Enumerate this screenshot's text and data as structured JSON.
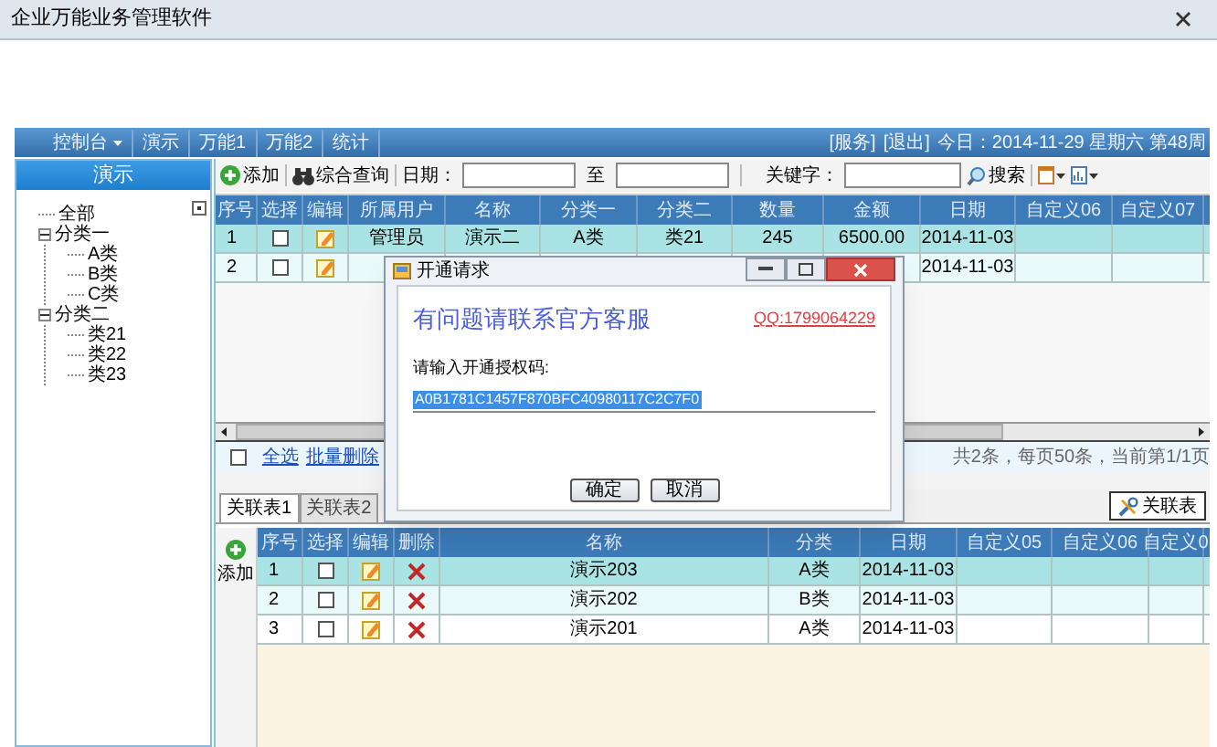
{
  "window": {
    "title": "企业万能业务管理软件"
  },
  "menu": {
    "items": [
      {
        "label": "控制台",
        "dropdown": true
      },
      {
        "label": "演示",
        "dropdown": false
      },
      {
        "label": "万能1",
        "dropdown": false
      },
      {
        "label": "万能2",
        "dropdown": false
      },
      {
        "label": "统计",
        "dropdown": false
      }
    ],
    "links": [
      "[服务]",
      "[退出]"
    ],
    "today": "今日：2014-11-29 星期六 第48周"
  },
  "sidebar": {
    "title": "演示",
    "tree": [
      {
        "label": "全部"
      },
      {
        "label": "分类一",
        "expanded": true,
        "children": [
          {
            "label": "A类"
          },
          {
            "label": "B类"
          },
          {
            "label": "C类"
          }
        ]
      },
      {
        "label": "分类二",
        "expanded": true,
        "children": [
          {
            "label": "类21"
          },
          {
            "label": "类22"
          },
          {
            "label": "类23"
          }
        ]
      }
    ]
  },
  "toolbar": {
    "add": "添加",
    "query": "综合查询",
    "date_label": "日期：",
    "to_label": "至",
    "keyword_label": "关键字：",
    "search": "搜索"
  },
  "grid": {
    "columns": [
      "序号",
      "选择",
      "编辑",
      "所属用户",
      "名称",
      "分类一",
      "分类二",
      "数量",
      "金额",
      "日期",
      "自定义06",
      "自定义07"
    ],
    "rows": [
      {
        "selected": true,
        "checked": false,
        "cells": [
          "1",
          "",
          "",
          "管理员",
          "演示二",
          "A类",
          "类21",
          "245",
          "6500.00",
          "2014-11-03",
          "",
          ""
        ]
      },
      {
        "selected": false,
        "checked": false,
        "cells": [
          "2",
          "",
          "",
          "",
          "",
          "",
          "",
          "",
          "",
          "2014-11-03",
          "",
          ""
        ]
      }
    ]
  },
  "footer": {
    "select_all": "全选",
    "checked": false,
    "batch_delete": "批量删除",
    "paging": "共2条，每页50条，当前第1/1页"
  },
  "tabs": [
    {
      "label": "关联表1",
      "selected": true
    },
    {
      "label": "关联表2",
      "selected": false
    }
  ],
  "related_button": "关联表",
  "subgrid": {
    "add": "添加",
    "columns": [
      "序号",
      "选择",
      "编辑",
      "删除",
      "名称",
      "分类",
      "日期",
      "自定义05",
      "自定义06",
      "自定义0"
    ],
    "rows": [
      {
        "selected": true,
        "checked": false,
        "cells": [
          "1",
          "",
          "",
          "",
          "演示203",
          "A类",
          "2014-11-03",
          "",
          "",
          ""
        ]
      },
      {
        "selected": false,
        "checked": false,
        "cells": [
          "2",
          "",
          "",
          "",
          "演示202",
          "B类",
          "2014-11-03",
          "",
          "",
          ""
        ]
      },
      {
        "selected": false,
        "checked": false,
        "cells": [
          "3",
          "",
          "",
          "",
          "演示201",
          "A类",
          "2014-11-03",
          "",
          "",
          ""
        ]
      }
    ]
  },
  "dialog": {
    "title": "开通请求",
    "heading": "有问题请联系官方客服",
    "qq": "QQ:1799064229",
    "prompt": "请输入开通授权码:",
    "code": "A0B1781C1457F870BFC40980117C2C7F0",
    "ok": "确定",
    "cancel": "取消"
  }
}
